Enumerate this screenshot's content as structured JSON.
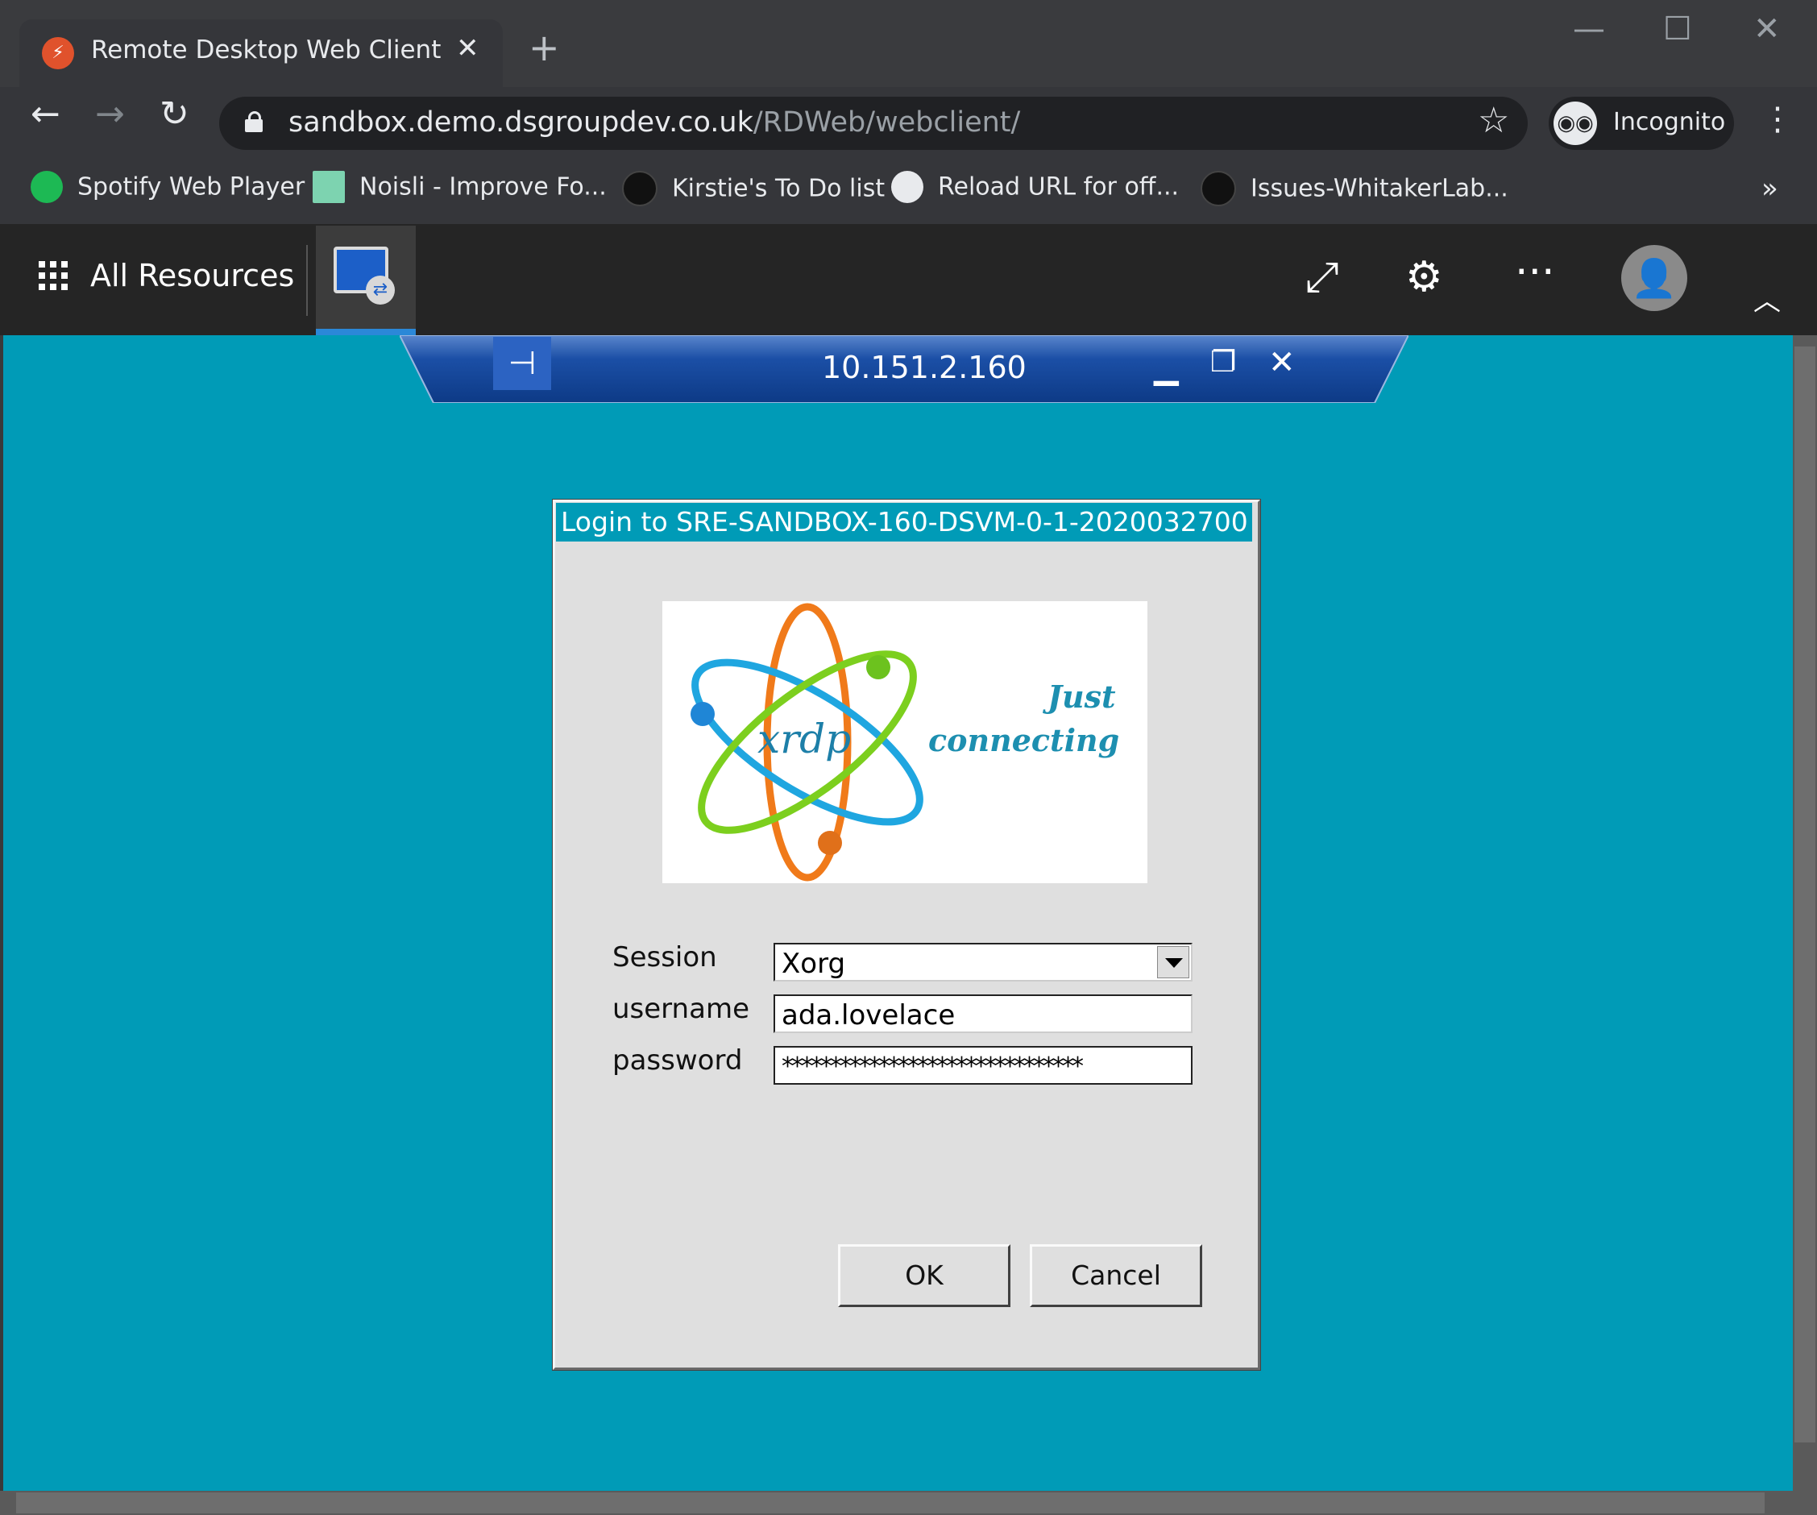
{
  "browser": {
    "tab_title": "Remote Desktop Web Client",
    "tab_close": "✕",
    "new_tab": "+",
    "window_controls": {
      "minimize": "—",
      "maximize": "☐",
      "close": "✕"
    },
    "url_domain": "sandbox.demo.dsgroupdev.co.uk",
    "url_path": "/RDWeb/webclient/",
    "incognito_label": "Incognito",
    "bookmarks": [
      {
        "label": "Spotify Web Player",
        "icon": "spotify-icon",
        "color": "#1db954"
      },
      {
        "label": "Noisli - Improve Fo...",
        "icon": "noisli-icon",
        "color": "#7dd3b0"
      },
      {
        "label": "Kirstie's To Do list",
        "icon": "github-icon",
        "color": "#111111"
      },
      {
        "label": "Reload URL for off...",
        "icon": "globe-icon",
        "color": "#e8eaed"
      },
      {
        "label": "Issues-WhitakerLab...",
        "icon": "github-icon",
        "color": "#111111"
      }
    ],
    "bookmarks_more": "»"
  },
  "rd_client": {
    "all_resources_label": "All Resources",
    "connection_bar_ip": "10.151.2.160"
  },
  "login_dialog": {
    "title": "Login to SRE-SANDBOX-160-DSVM-0-1-2020032700",
    "logo_text_main": "xrdp",
    "logo_tagline_1": "Just",
    "logo_tagline_2": "connecting",
    "session_label": "Session",
    "session_value": "Xorg",
    "username_label": "username",
    "username_value": "ada.lovelace",
    "password_label": "password",
    "password_value": "*******************************",
    "ok_label": "OK",
    "cancel_label": "Cancel"
  },
  "colors": {
    "desktop_bg": "#009bb7",
    "browser_dark": "#35363a",
    "accent_blue": "#2b88d8"
  }
}
